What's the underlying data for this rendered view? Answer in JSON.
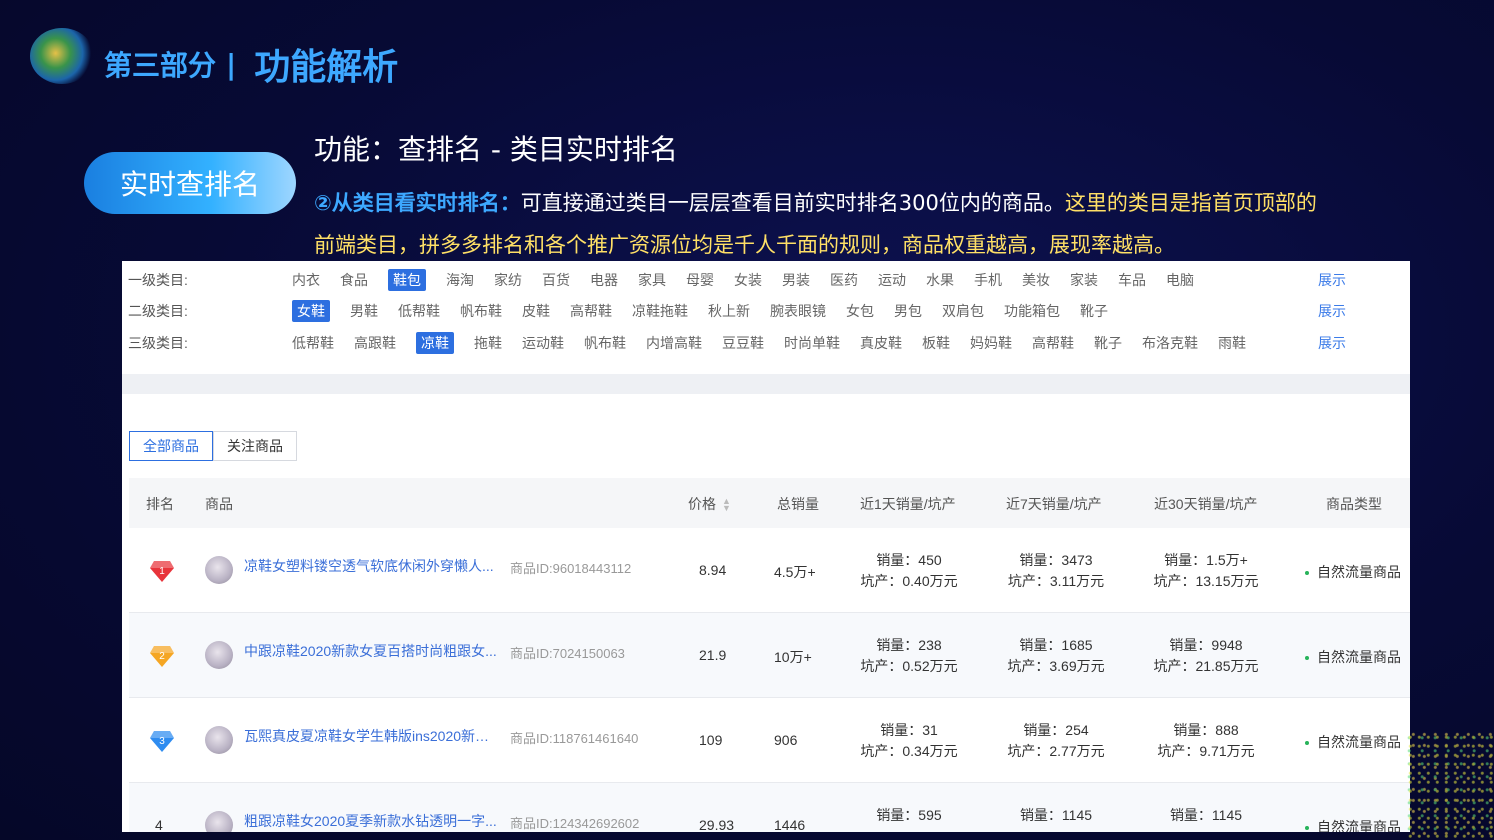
{
  "header": {
    "section_part": "第三部分",
    "section_separator": "|",
    "section_title": "功能解析"
  },
  "pill_label": "实时查排名",
  "function_title": "功能：查排名 - 类目实时排名",
  "description": {
    "lead": "②从类目看实时排名：",
    "body": "可直接通过类目一层层查看目前实时排名300位内的商品。",
    "highlight": "这里的类目是指首页顶部的前端类目，拼多多排名和各个推广资源位均是千人千面的规则，商品权重越高，展现率越高。"
  },
  "categories": {
    "level1": {
      "label": "一级类目:",
      "items": [
        "内衣",
        "食品",
        "鞋包",
        "海淘",
        "家纺",
        "百货",
        "电器",
        "家具",
        "母婴",
        "女装",
        "男装",
        "医药",
        "运动",
        "水果",
        "手机",
        "美妆",
        "家装",
        "车品",
        "电脑"
      ],
      "active_index": 2,
      "show": "展示"
    },
    "level2": {
      "label": "二级类目:",
      "items": [
        "女鞋",
        "男鞋",
        "低帮鞋",
        "帆布鞋",
        "皮鞋",
        "高帮鞋",
        "凉鞋拖鞋",
        "秋上新",
        "腕表眼镜",
        "女包",
        "男包",
        "双肩包",
        "功能箱包",
        "靴子"
      ],
      "active_index": 0,
      "show": "展示"
    },
    "level3": {
      "label": "三级类目:",
      "items": [
        "低帮鞋",
        "高跟鞋",
        "凉鞋",
        "拖鞋",
        "运动鞋",
        "帆布鞋",
        "内增高鞋",
        "豆豆鞋",
        "时尚单鞋",
        "真皮鞋",
        "板鞋",
        "妈妈鞋",
        "高帮鞋",
        "靴子",
        "布洛克鞋",
        "雨鞋"
      ],
      "active_index": 2,
      "show": "展示"
    }
  },
  "tabs": [
    "全部商品",
    "关注商品"
  ],
  "table": {
    "headers": {
      "rank": "排名",
      "product": "商品",
      "price": "价格",
      "total": "总销量",
      "d1": "近1天销量/坑产",
      "d7": "近7天销量/坑产",
      "d30": "近30天销量/坑产",
      "type": "商品类型"
    },
    "rows": [
      {
        "rank": "1",
        "name": "凉鞋女塑料镂空透气软底休闲外穿懒人...",
        "id": "商品ID:96018443112",
        "price": "8.94",
        "total": "4.5万+",
        "d1_sales": "销量：450",
        "d1_output": "坑产：0.40万元",
        "d7_sales": "销量：3473",
        "d7_output": "坑产：3.11万元",
        "d30_sales": "销量：1.5万+",
        "d30_output": "坑产：13.15万元",
        "type": "自然流量商品"
      },
      {
        "rank": "2",
        "name": "中跟凉鞋2020新款女夏百搭时尚粗跟女...",
        "id": "商品ID:7024150063",
        "price": "21.9",
        "total": "10万+",
        "d1_sales": "销量：238",
        "d1_output": "坑产：0.52万元",
        "d7_sales": "销量：1685",
        "d7_output": "坑产：3.69万元",
        "d30_sales": "销量：9948",
        "d30_output": "坑产：21.85万元",
        "type": "自然流量商品"
      },
      {
        "rank": "3",
        "name": "瓦熙真皮夏凉鞋女学生韩版ins2020新款...",
        "id": "商品ID:118761461640",
        "price": "109",
        "total": "906",
        "d1_sales": "销量：31",
        "d1_output": "坑产：0.34万元",
        "d7_sales": "销量：254",
        "d7_output": "坑产：2.77万元",
        "d30_sales": "销量：888",
        "d30_output": "坑产：9.71万元",
        "type": "自然流量商品"
      },
      {
        "rank": "4",
        "name": "粗跟凉鞋女2020夏季新款水钻透明一字...",
        "id": "商品ID:124342692602",
        "price": "29.93",
        "total": "1446",
        "d1_sales": "销量：595",
        "d1_output": "",
        "d7_sales": "销量：1145",
        "d7_output": "",
        "d30_sales": "销量：1145",
        "d30_output": "",
        "type": "自然流量商品"
      }
    ]
  },
  "colors": {
    "background": "#070a35",
    "accent_blue": "#3da8ff",
    "highlight_yellow": "#ffe066",
    "link_blue": "#3b6fd8",
    "active_blue": "#2d6fe0",
    "rank1": "#e8343b",
    "rank2": "#f5a623",
    "rank3": "#2f8cf0"
  },
  "icons": {
    "rank_badges": [
      "ruby-gem-icon",
      "gold-gem-icon",
      "sapphire-gem-icon"
    ],
    "sort": "sort-arrows-icon"
  }
}
